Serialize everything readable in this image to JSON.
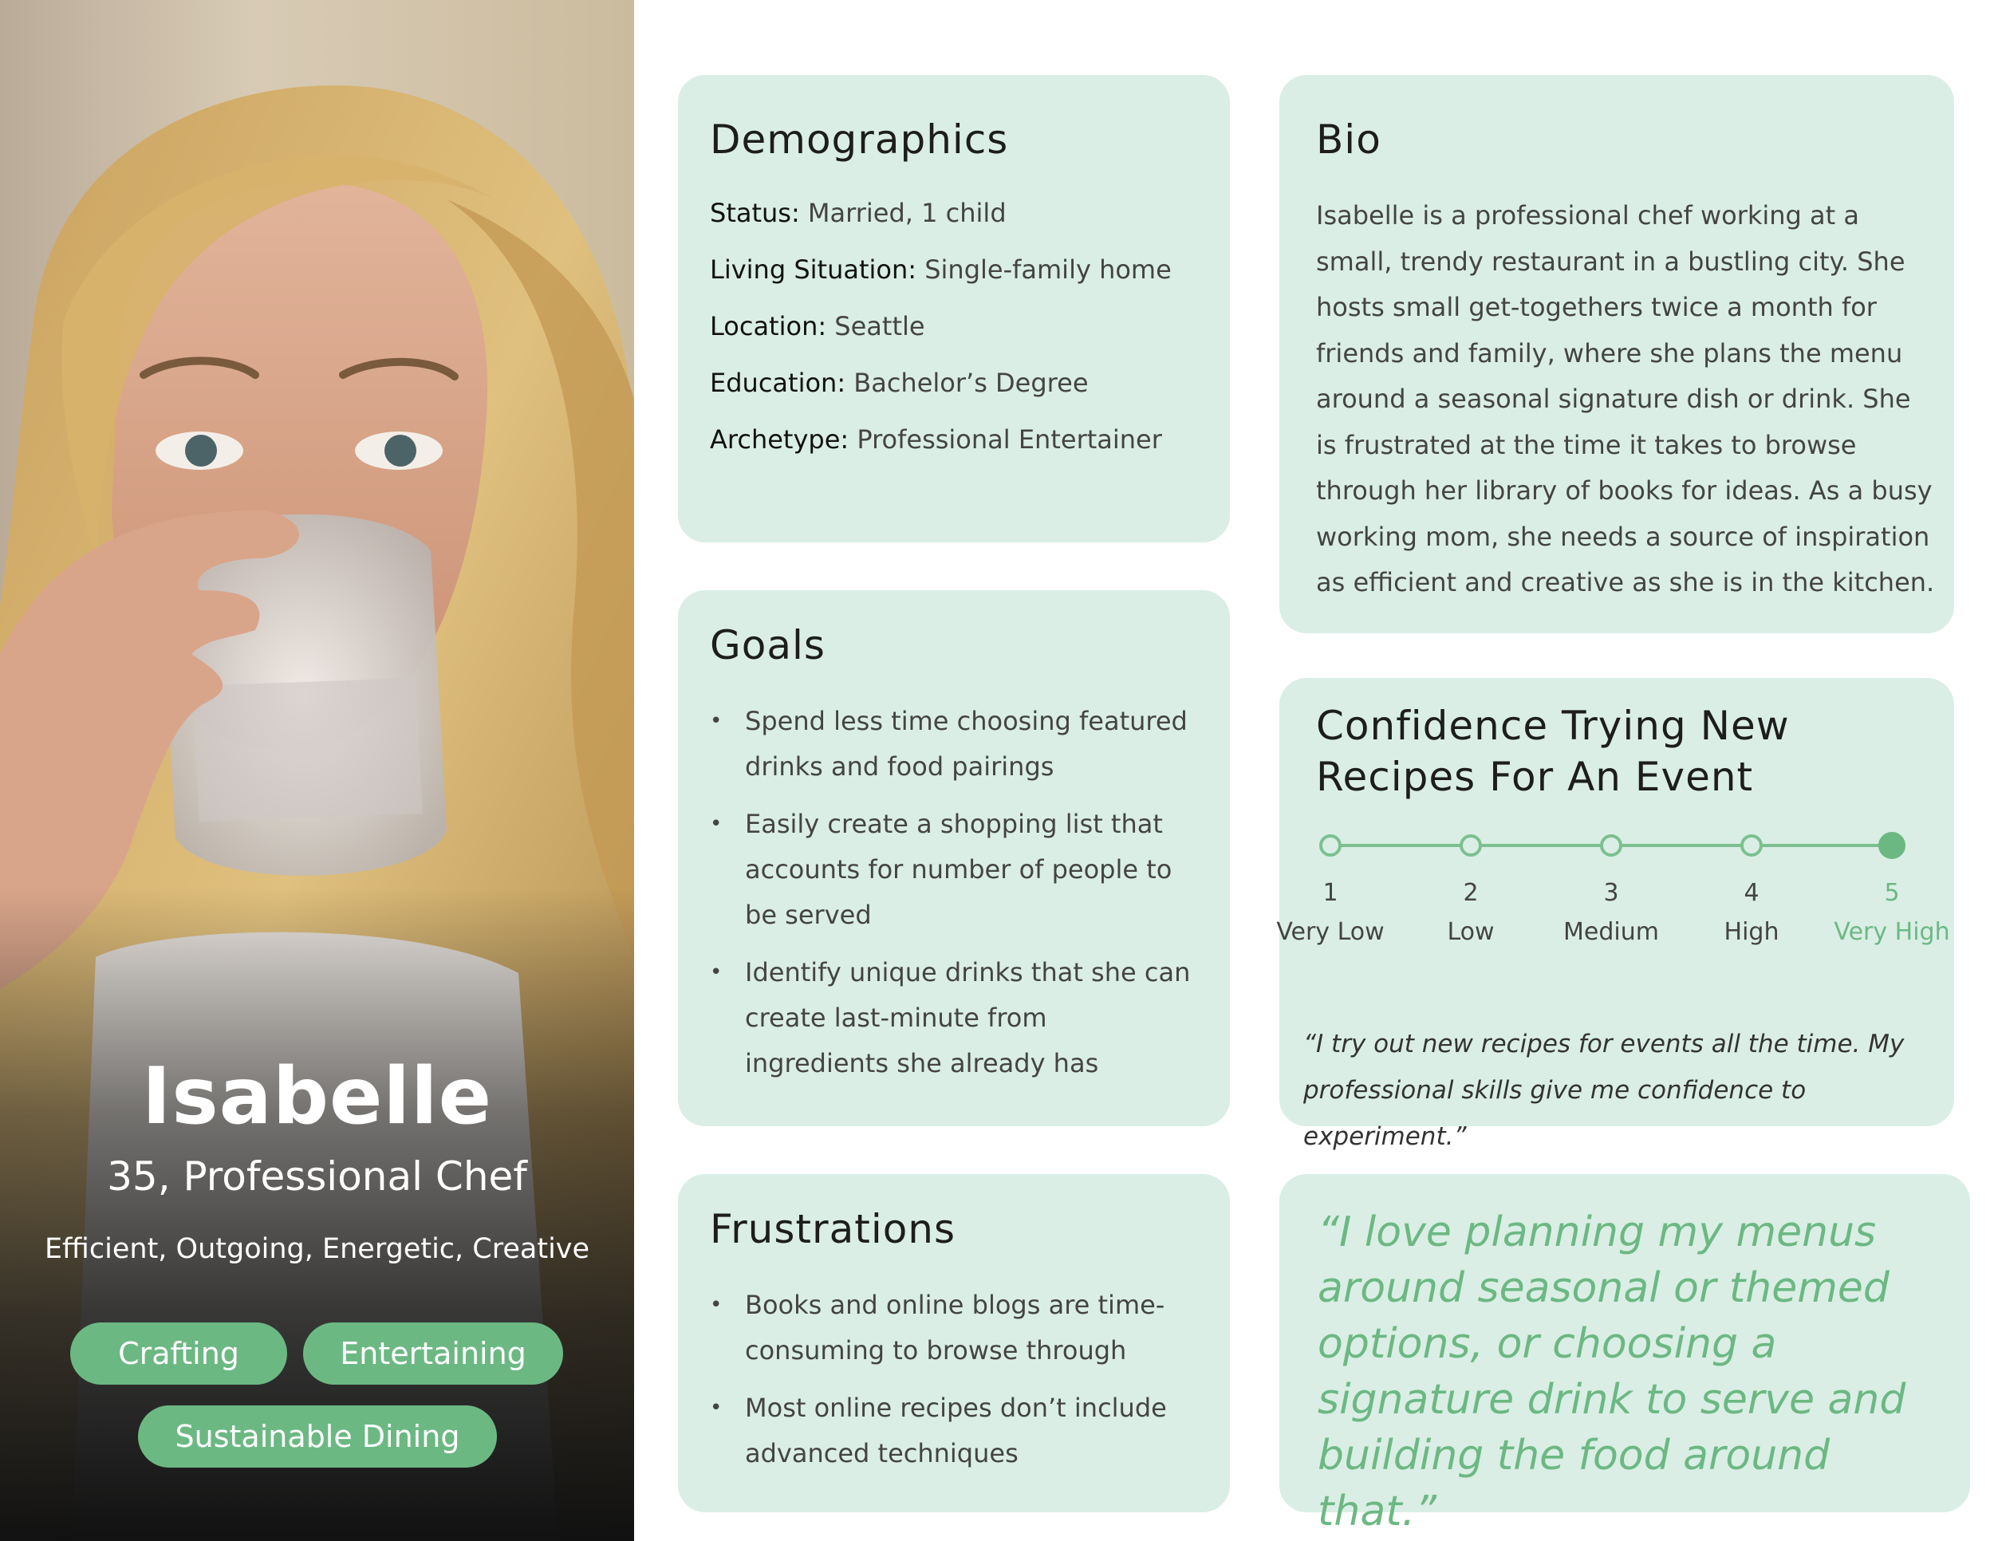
{
  "persona": {
    "name": "Isabelle",
    "role": "35, Professional Chef",
    "traits": "Efficient, Outgoing, Energetic, Creative",
    "tags": [
      "Crafting",
      "Entertaining",
      "Sustainable Dining"
    ]
  },
  "demographics": {
    "title": "Demographics",
    "fields": [
      {
        "key": "Status:",
        "value": "Married, 1 child"
      },
      {
        "key": "Living Situation:",
        "value": "Single-family home"
      },
      {
        "key": "Location:",
        "value": "Seattle"
      },
      {
        "key": "Education:",
        "value": "Bachelor’s Degree"
      },
      {
        "key": "Archetype:",
        "value": "Professional Entertainer"
      }
    ]
  },
  "bio": {
    "title": "Bio",
    "text": "Isabelle is a professional chef working at a small, trendy restaurant in a bustling city. She hosts small get-togethers twice a month for friends and family, where she plans the menu around a seasonal signature dish or drink. She is frustrated at the time it takes to browse through her library of books for ideas. As a busy working mom, she needs a source of inspiration as efficient and creative as she is in the kitchen."
  },
  "goals": {
    "title": "Goals",
    "items": [
      "Spend less time choosing featured drinks and food pairings",
      "Easily create a shopping list that accounts for number of people to be served",
      "Identify unique drinks that she can create last-minute from ingredients she already has"
    ]
  },
  "confidence": {
    "title_line1": "Confidence Trying New",
    "title_line2": "Recipes For An Event",
    "scale": [
      {
        "num": "1",
        "label": "Very Low"
      },
      {
        "num": "2",
        "label": "Low"
      },
      {
        "num": "3",
        "label": "Medium"
      },
      {
        "num": "4",
        "label": "High"
      },
      {
        "num": "5",
        "label": "Very High"
      }
    ],
    "selected": 5,
    "quote": "“I try out new recipes for events all the time. My professional skills give me confidence to experiment.”"
  },
  "frustrations": {
    "title": "Frustrations",
    "items": [
      "Books and online blogs are time-consuming to browse through",
      "Most online recipes don’t include advanced techniques"
    ]
  },
  "quote": {
    "text": "“I love planning my menus around seasonal or themed options, or choosing a signature drink to serve and building the food around that.”"
  },
  "colors": {
    "card_bg": "#daeee5",
    "accent": "#6cb883"
  }
}
